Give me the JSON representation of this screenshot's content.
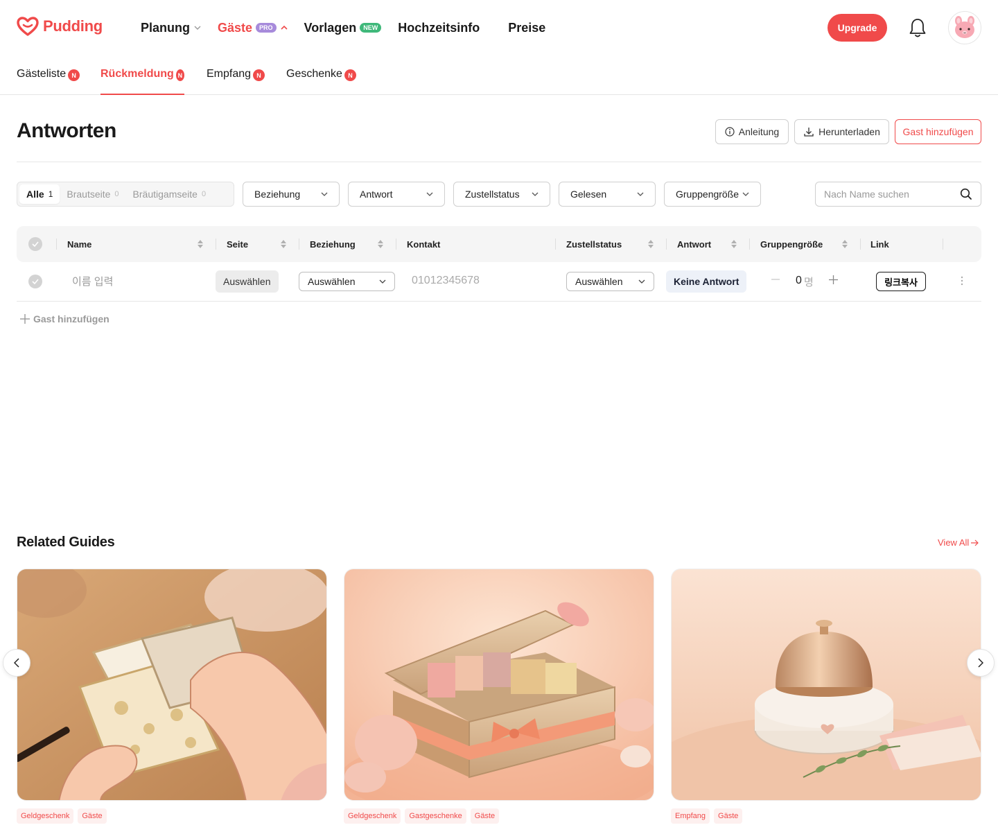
{
  "brand": {
    "name": "Pudding",
    "color": "#f04a4a"
  },
  "nav": {
    "items": [
      {
        "label": "Planung",
        "has_chevron": "down"
      },
      {
        "label": "Gäste",
        "badge": "PRO",
        "has_chevron": "up",
        "active": true
      },
      {
        "label": "Vorlagen",
        "badge": "NEW"
      },
      {
        "label": "Hochzeitsinfo"
      },
      {
        "label": "Preise"
      }
    ],
    "upgrade_label": "Upgrade",
    "icons": {
      "bell": "bell-icon",
      "avatar": "pink-bunny-avatar"
    }
  },
  "subtabs": [
    {
      "label": "Gästeliste",
      "badge": "N"
    },
    {
      "label": "Rückmeldung",
      "badge": "N",
      "active": true
    },
    {
      "label": "Empfang",
      "badge": "N"
    },
    {
      "label": "Geschenke",
      "badge": "N"
    }
  ],
  "page": {
    "title": "Antworten",
    "actions": {
      "guide": "Anleitung",
      "download": "Herunterladen",
      "add_guest": "Gast hinzufügen"
    }
  },
  "filters": {
    "segments": [
      {
        "label": "Alle",
        "count": "1",
        "active": true
      },
      {
        "label": "Brautseite",
        "count": "0"
      },
      {
        "label": "Bräutigamseite",
        "count": "0"
      }
    ],
    "dropdowns": [
      "Beziehung",
      "Antwort",
      "Zustellstatus",
      "Gelesen",
      "Gruppengröße"
    ],
    "search_placeholder": "Nach Name suchen"
  },
  "table": {
    "columns": [
      "Name",
      "Seite",
      "Beziehung",
      "Kontakt",
      "Zustellstatus",
      "Antwort",
      "Gruppengröße",
      "Link"
    ],
    "rows": [
      {
        "name_placeholder": "이름 입력",
        "side": "Auswählen",
        "relation": "Auswählen",
        "contact_placeholder": "01012345678",
        "delivery": "Auswählen",
        "answer": "Keine Antwort",
        "group_size": "0",
        "group_unit": "명",
        "link": "링크복사"
      }
    ],
    "add_row_label": "Gast hinzufügen"
  },
  "related": {
    "title": "Related Guides",
    "view_all": "View All",
    "cards": [
      {
        "tags": [
          "Geldgeschenk",
          "Gäste"
        ],
        "image": "hands-opening-envelopes",
        "title": ""
      },
      {
        "tags": [
          "Geldgeschenk",
          "Gastgeschenke",
          "Gäste"
        ],
        "image": "gift-box-with-envelopes",
        "title": ""
      },
      {
        "tags": [
          "Empfang",
          "Gäste"
        ],
        "image": "reception-bell",
        "title": ""
      }
    ]
  }
}
